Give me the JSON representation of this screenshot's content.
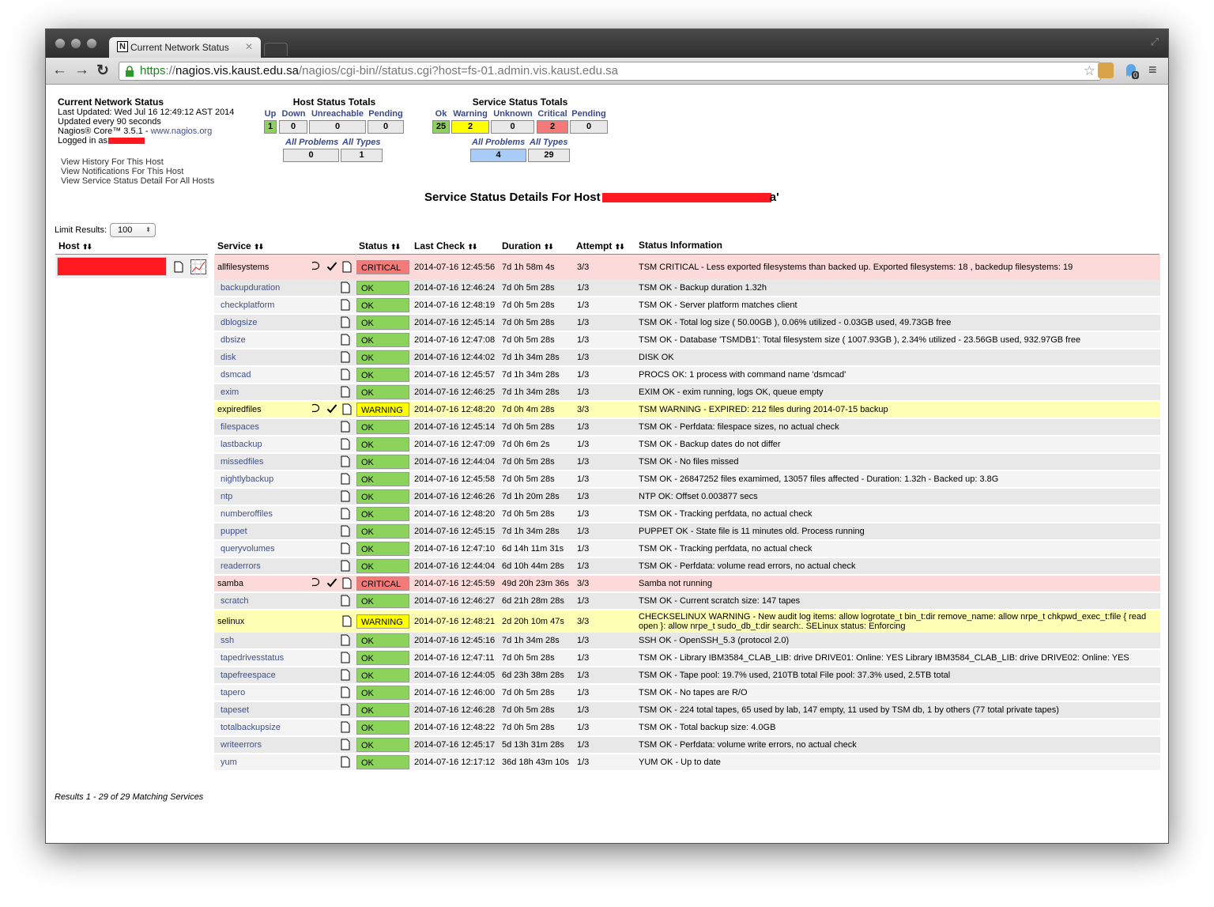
{
  "browser": {
    "tab_title": "Current Network Status",
    "favicon_letter": "N",
    "url_scheme": "https",
    "url_separator": "://",
    "url_domain": "nagios.vis.kaust.edu.sa",
    "url_path": "/nagios/cgi-bin//status.cgi?host=fs-01.admin.vis.kaust.edu.sa",
    "badge_count": "0"
  },
  "info": {
    "title": "Current Network Status",
    "last_updated": "Last Updated: Wed Jul 16 12:49:12 AST 2014",
    "update_interval": "Updated every 90 seconds",
    "version": "Nagios® Core™ 3.5.1 -",
    "version_link": "www.nagios.org",
    "logged_in": "Logged in as",
    "links": [
      "View History For This Host",
      "View Notifications For This Host",
      "View Service Status Detail For All Hosts"
    ]
  },
  "host_totals": {
    "title": "Host Status Totals",
    "headers": [
      "Up",
      "Down",
      "Unreachable",
      "Pending"
    ],
    "values": [
      "1",
      "0",
      "0",
      "0"
    ],
    "sub_headers": [
      "All Problems",
      "All Types"
    ],
    "sub_values": [
      "0",
      "1"
    ]
  },
  "service_totals": {
    "title": "Service Status Totals",
    "headers": [
      "Ok",
      "Warning",
      "Unknown",
      "Critical",
      "Pending"
    ],
    "values": [
      "25",
      "2",
      "0",
      "2",
      "0"
    ],
    "sub_headers": [
      "All Problems",
      "All Types"
    ],
    "sub_values": [
      "4",
      "29"
    ]
  },
  "page_heading": "Service Status Details For Host",
  "heading_tail": "a'",
  "limit": {
    "label": "Limit Results:",
    "value": "100"
  },
  "columns": {
    "host": "Host",
    "service": "Service",
    "status": "Status",
    "last_check": "Last Check",
    "duration": "Duration",
    "attempt": "Attempt",
    "info": "Status Information"
  },
  "services": [
    {
      "name": "allfilesystems",
      "status": "CRITICAL",
      "last_check": "2014-07-16 12:45:56",
      "duration": "7d 1h 58m 4s",
      "attempt": "3/3",
      "info": "TSM CRITICAL - Less exported filesystems than backed up. Exported filesystems: 18 , backedup filesystems: 19"
    },
    {
      "name": "backupduration",
      "status": "OK",
      "last_check": "2014-07-16 12:46:24",
      "duration": "7d 0h 5m 28s",
      "attempt": "1/3",
      "info": "TSM OK - Backup duration 1.32h"
    },
    {
      "name": "checkplatform",
      "status": "OK",
      "last_check": "2014-07-16 12:48:19",
      "duration": "7d 0h 5m 28s",
      "attempt": "1/3",
      "info": "TSM OK - Server platform matches client"
    },
    {
      "name": "dblogsize",
      "status": "OK",
      "last_check": "2014-07-16 12:45:14",
      "duration": "7d 0h 5m 28s",
      "attempt": "1/3",
      "info": "TSM OK - Total log size ( 50.00GB ), 0.06% utilized - 0.03GB used, 49.73GB free"
    },
    {
      "name": "dbsize",
      "status": "OK",
      "last_check": "2014-07-16 12:47:08",
      "duration": "7d 0h 5m 28s",
      "attempt": "1/3",
      "info": "TSM OK - Database 'TSMDB1': Total filesystem size ( 1007.93GB ), 2.34% utilized - 23.56GB used, 932.97GB free"
    },
    {
      "name": "disk",
      "status": "OK",
      "last_check": "2014-07-16 12:44:02",
      "duration": "7d 1h 34m 28s",
      "attempt": "1/3",
      "info": "DISK OK"
    },
    {
      "name": "dsmcad",
      "status": "OK",
      "last_check": "2014-07-16 12:45:57",
      "duration": "7d 1h 34m 28s",
      "attempt": "1/3",
      "info": "PROCS OK: 1 process with command name 'dsmcad'"
    },
    {
      "name": "exim",
      "status": "OK",
      "last_check": "2014-07-16 12:46:25",
      "duration": "7d 1h 34m 28s",
      "attempt": "1/3",
      "info": "EXIM OK - exim running, logs OK, queue empty"
    },
    {
      "name": "expiredfiles",
      "status": "WARNING",
      "last_check": "2014-07-16 12:48:20",
      "duration": "7d 0h 4m 28s",
      "attempt": "3/3",
      "info": "TSM WARNING - EXPIRED: 212 files during 2014-07-15 backup"
    },
    {
      "name": "filespaces",
      "status": "OK",
      "last_check": "2014-07-16 12:45:14",
      "duration": "7d 0h 5m 28s",
      "attempt": "1/3",
      "info": "TSM OK - Perfdata: filespace sizes, no actual check"
    },
    {
      "name": "lastbackup",
      "status": "OK",
      "last_check": "2014-07-16 12:47:09",
      "duration": "7d 0h 6m 2s",
      "attempt": "1/3",
      "info": "TSM OK - Backup dates do not differ"
    },
    {
      "name": "missedfiles",
      "status": "OK",
      "last_check": "2014-07-16 12:44:04",
      "duration": "7d 0h 5m 28s",
      "attempt": "1/3",
      "info": "TSM OK - No files missed"
    },
    {
      "name": "nightlybackup",
      "status": "OK",
      "last_check": "2014-07-16 12:45:58",
      "duration": "7d 0h 5m 28s",
      "attempt": "1/3",
      "info": "TSM OK - 26847252 files examimed, 13057 files affected - Duration: 1.32h - Backed up: 3.8G"
    },
    {
      "name": "ntp",
      "status": "OK",
      "last_check": "2014-07-16 12:46:26",
      "duration": "7d 1h 20m 28s",
      "attempt": "1/3",
      "info": "NTP OK: Offset 0.003877 secs"
    },
    {
      "name": "numberoffiles",
      "status": "OK",
      "last_check": "2014-07-16 12:48:20",
      "duration": "7d 0h 5m 28s",
      "attempt": "1/3",
      "info": "TSM OK - Tracking perfdata, no actual check"
    },
    {
      "name": "puppet",
      "status": "OK",
      "last_check": "2014-07-16 12:45:15",
      "duration": "7d 1h 34m 28s",
      "attempt": "1/3",
      "info": "PUPPET OK - State file is 11 minutes old. Process running"
    },
    {
      "name": "queryvolumes",
      "status": "OK",
      "last_check": "2014-07-16 12:47:10",
      "duration": "6d 14h 11m 31s",
      "attempt": "1/3",
      "info": "TSM OK - Tracking perfdata, no actual check"
    },
    {
      "name": "readerrors",
      "status": "OK",
      "last_check": "2014-07-16 12:44:04",
      "duration": "6d 10h 44m 28s",
      "attempt": "1/3",
      "info": "TSM OK - Perfdata: volume read errors, no actual check"
    },
    {
      "name": "samba",
      "status": "CRITICAL",
      "last_check": "2014-07-16 12:45:59",
      "duration": "49d 20h 23m 36s",
      "attempt": "3/3",
      "info": "Samba not running"
    },
    {
      "name": "scratch",
      "status": "OK",
      "last_check": "2014-07-16 12:46:27",
      "duration": "6d 21h 28m 28s",
      "attempt": "1/3",
      "info": "TSM OK - Current scratch size: 147 tapes"
    },
    {
      "name": "selinux",
      "status": "WARNING",
      "last_check": "2014-07-16 12:48:21",
      "duration": "2d 20h 10m 47s",
      "attempt": "3/3",
      "info": "CHECKSELINUX WARNING - New audit log items: allow logrotate_t bin_t:dir remove_name: allow nrpe_t chkpwd_exec_t:file { read open }: allow nrpe_t sudo_db_t:dir search:. SELinux status: Enforcing"
    },
    {
      "name": "ssh",
      "status": "OK",
      "last_check": "2014-07-16 12:45:16",
      "duration": "7d 1h 34m 28s",
      "attempt": "1/3",
      "info": "SSH OK - OpenSSH_5.3 (protocol 2.0)"
    },
    {
      "name": "tapedrivesstatus",
      "status": "OK",
      "last_check": "2014-07-16 12:47:11",
      "duration": "7d 0h 5m 28s",
      "attempt": "1/3",
      "info": "TSM OK - Library IBM3584_CLAB_LIB: drive DRIVE01: Online: YES Library IBM3584_CLAB_LIB: drive DRIVE02: Online: YES"
    },
    {
      "name": "tapefreespace",
      "status": "OK",
      "last_check": "2014-07-16 12:44:05",
      "duration": "6d 23h 38m 28s",
      "attempt": "1/3",
      "info": "TSM OK - Tape pool: 19.7% used, 210TB total File pool: 37.3% used, 2.5TB total"
    },
    {
      "name": "tapero",
      "status": "OK",
      "last_check": "2014-07-16 12:46:00",
      "duration": "7d 0h 5m 28s",
      "attempt": "1/3",
      "info": "TSM OK - No tapes are R/O"
    },
    {
      "name": "tapeset",
      "status": "OK",
      "last_check": "2014-07-16 12:46:28",
      "duration": "7d 0h 5m 28s",
      "attempt": "1/3",
      "info": "TSM OK - 224 total tapes, 65 used by lab, 147 empty, 11 used by TSM db, 1 by others (77 total private tapes)"
    },
    {
      "name": "totalbackupsize",
      "status": "OK",
      "last_check": "2014-07-16 12:48:22",
      "duration": "7d 0h 5m 28s",
      "attempt": "1/3",
      "info": "TSM OK - Total backup size: 4.0GB"
    },
    {
      "name": "writeerrors",
      "status": "OK",
      "last_check": "2014-07-16 12:45:17",
      "duration": "5d 13h 31m 28s",
      "attempt": "1/3",
      "info": "TSM OK - Perfdata: volume write errors, no actual check"
    },
    {
      "name": "yum",
      "status": "OK",
      "last_check": "2014-07-16 12:17:12",
      "duration": "36d 18h 43m 10s",
      "attempt": "1/3",
      "info": "YUM OK - Up to date"
    }
  ],
  "footer": "Results 1 - 29 of 29 Matching Services",
  "colors": {
    "ok_bg": "#8cd35c",
    "warning_bg": "#ffff00",
    "critical_bg": "#f47a7a",
    "row_critical": "#fcdada",
    "row_warning": "#fefeb4",
    "row_even": "#e8e8e8",
    "row_odd": "#f4f4f4",
    "problems_bg": "#a9cbf7"
  }
}
